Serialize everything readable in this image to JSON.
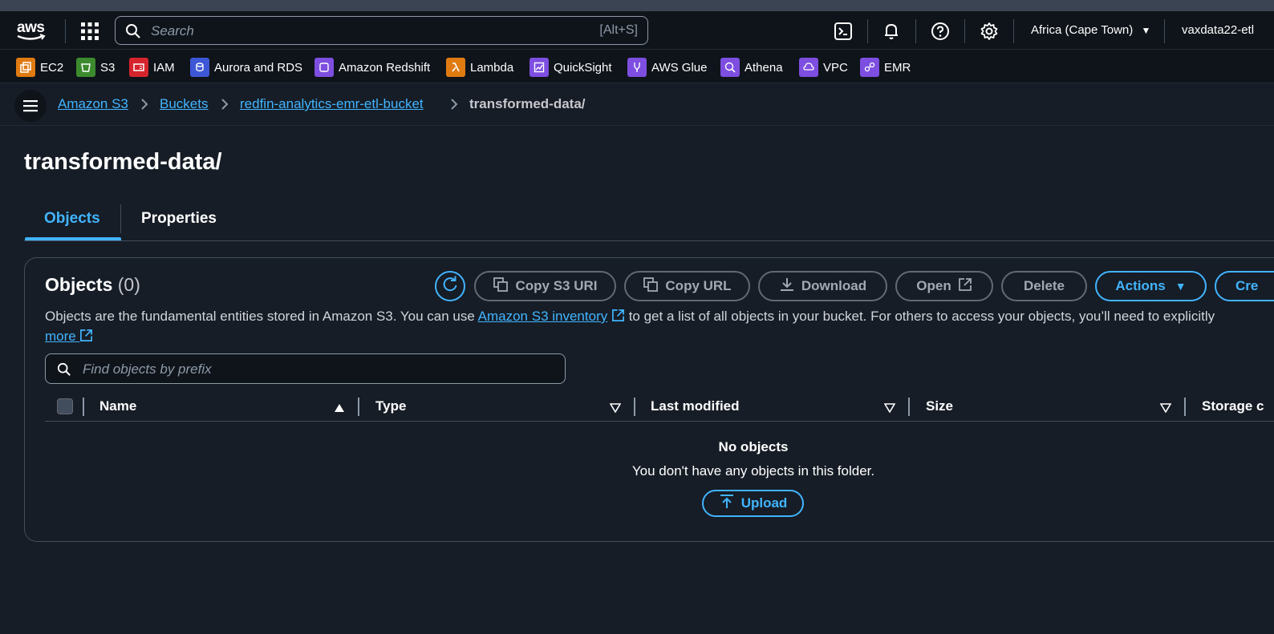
{
  "nav": {
    "logo": "aws",
    "search_placeholder": "Search",
    "search_shortcut": "[Alt+S]",
    "region": "Africa (Cape Town)",
    "account": "vaxdata22-etl"
  },
  "favorites": [
    {
      "label": "EC2",
      "color": "#e07b12",
      "icon": "ec2-icon"
    },
    {
      "label": "S3",
      "color": "#3c8a2e",
      "icon": "s3-icon"
    },
    {
      "label": "IAM",
      "color": "#d6242d",
      "icon": "iam-icon"
    },
    {
      "label": "Aurora and RDS",
      "color": "#3e57d6",
      "icon": "rds-icon"
    },
    {
      "label": "Amazon Redshift",
      "color": "#7d4ee0",
      "icon": "redshift-icon"
    },
    {
      "label": "Lambda",
      "color": "#e07b12",
      "icon": "lambda-icon"
    },
    {
      "label": "QuickSight",
      "color": "#7d4ee0",
      "icon": "quicksight-icon"
    },
    {
      "label": "AWS Glue",
      "color": "#7d4ee0",
      "icon": "glue-icon"
    },
    {
      "label": "Athena",
      "color": "#7d4ee0",
      "icon": "athena-icon"
    },
    {
      "label": "VPC",
      "color": "#7d4ee0",
      "icon": "vpc-icon"
    },
    {
      "label": "EMR",
      "color": "#7d4ee0",
      "icon": "emr-icon"
    }
  ],
  "breadcrumb": {
    "items": [
      "Amazon S3",
      "Buckets",
      "redfin-analytics-emr-etl-bucket"
    ],
    "current": "transformed-data/"
  },
  "page": {
    "title": "transformed-data/",
    "tabs": [
      "Objects",
      "Properties"
    ]
  },
  "objects": {
    "title": "Objects",
    "count": "(0)",
    "buttons": {
      "copy_s3_uri": "Copy S3 URI",
      "copy_url": "Copy URL",
      "download": "Download",
      "open": "Open",
      "delete": "Delete",
      "actions": "Actions",
      "create": "Cre"
    },
    "description_1": "Objects are the fundamental entities stored in Amazon S3. You can use ",
    "description_link": "Amazon S3 inventory",
    "description_2": " to get a list of all objects in your bucket. For others to access your objects, you’ll need to explicitly",
    "description_more": "more",
    "filter_placeholder": "Find objects by prefix",
    "columns": [
      "Name",
      "Type",
      "Last modified",
      "Size",
      "Storage c"
    ],
    "empty_title": "No objects",
    "empty_message": "You don't have any objects in this folder.",
    "upload": "Upload"
  }
}
